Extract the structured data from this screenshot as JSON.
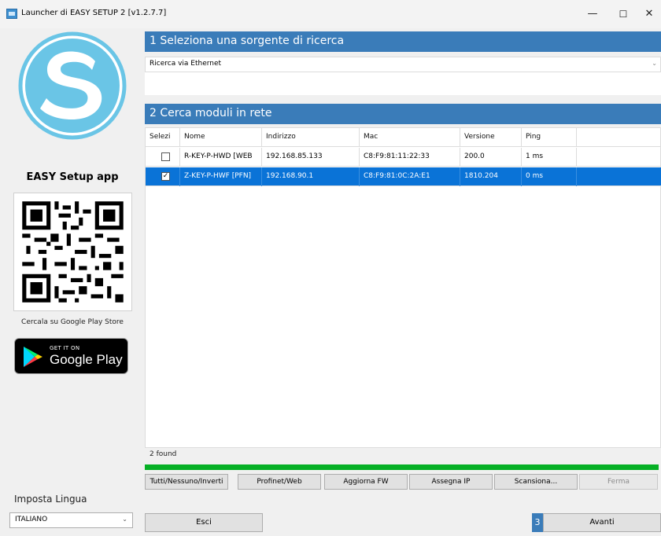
{
  "window": {
    "title": "Launcher di EASY SETUP 2 [v1.2.7.7]",
    "minimize": "—",
    "maximize": "☐",
    "close": "✕"
  },
  "left": {
    "app_name": "EASY Setup app",
    "store_text": "Cercala su Google Play Store",
    "badge_small": "GET IT ON",
    "badge_big": "Google Play",
    "lang_label": "Imposta Lingua",
    "lang_value": "ITALIANO"
  },
  "step1": {
    "header": "1  Seleziona una sorgente di ricerca",
    "source_value": "Ricerca via Ethernet"
  },
  "step2": {
    "header": "2  Cerca moduli in rete",
    "columns": [
      "Selezi",
      "Nome",
      "Indirizzo",
      "Mac",
      "Versione",
      "Ping"
    ],
    "rows": [
      {
        "checked": false,
        "name": "R-KEY-P-HWD [WEB",
        "address": "192.168.85.133",
        "mac": "C8:F9:81:11:22:33",
        "version": "200.0",
        "ping": "1 ms"
      },
      {
        "checked": true,
        "name": "Z-KEY-P-HWF [PFN]",
        "address": "192.168.90.1",
        "mac": "C8:F9:81:0C:2A:E1",
        "version": "1810.204",
        "ping": "0 ms"
      }
    ],
    "found_text": "2 found",
    "progress": 1.0
  },
  "buttons": {
    "all": "Tutti/Nessuno/Inverti",
    "profinet": "Profinet/Web",
    "update_fw": "Aggiorna FW",
    "assign_ip": "Assegna IP",
    "scan": "Scansiona...",
    "stop": "Ferma",
    "exit": "Esci",
    "step3": "3",
    "next": "Avanti"
  },
  "colors": {
    "header_blue": "#3a7cb9",
    "selection": "#0a73d7",
    "progress_green": "#06b025"
  }
}
